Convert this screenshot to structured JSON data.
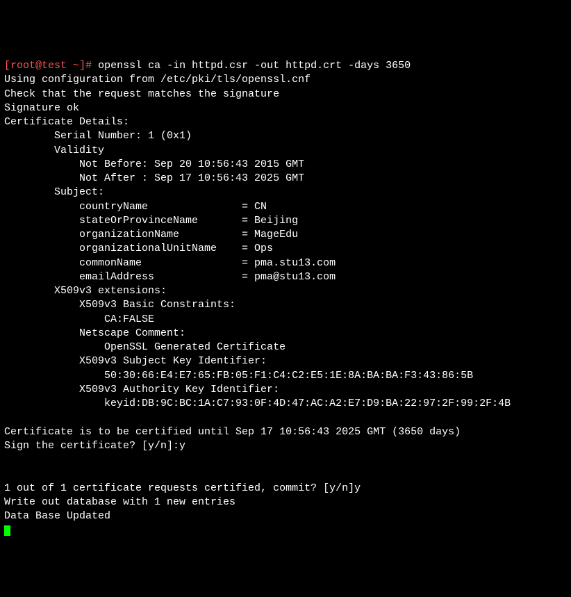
{
  "prompt": {
    "open": "[",
    "userhost": "root@test",
    "space": " ",
    "tilde": "~",
    "close": "]",
    "hash": "# "
  },
  "command": "openssl ca -in httpd.csr -out httpd.crt -days 3650",
  "lines": {
    "l1": "Using configuration from /etc/pki/tls/openssl.cnf",
    "l2": "Check that the request matches the signature",
    "l3": "Signature ok",
    "l4": "Certificate Details:",
    "l5": "        Serial Number: 1 (0x1)",
    "l6": "        Validity",
    "l7": "            Not Before: Sep 20 10:56:43 2015 GMT",
    "l8": "            Not After : Sep 17 10:56:43 2025 GMT",
    "l9": "        Subject:",
    "l10": "            countryName               = CN",
    "l11": "            stateOrProvinceName       = Beijing",
    "l12": "            organizationName          = MageEdu",
    "l13": "            organizationalUnitName    = Ops",
    "l14": "            commonName                = pma.stu13.com",
    "l15": "            emailAddress              = pma@stu13.com",
    "l16": "        X509v3 extensions:",
    "l17": "            X509v3 Basic Constraints: ",
    "l18": "                CA:FALSE",
    "l19": "            Netscape Comment: ",
    "l20": "                OpenSSL Generated Certificate",
    "l21": "            X509v3 Subject Key Identifier: ",
    "l22": "                50:30:66:E4:E7:65:FB:05:F1:C4:C2:E5:1E:8A:BA:BA:F3:43:86:5B",
    "l23": "            X509v3 Authority Key Identifier: ",
    "l24": "                keyid:DB:9C:BC:1A:C7:93:0F:4D:47:AC:A2:E7:D9:BA:22:97:2F:99:2F:4B",
    "l25": "",
    "l26": "Certificate is to be certified until Sep 17 10:56:43 2025 GMT (3650 days)",
    "l27": "Sign the certificate? [y/n]:y",
    "l28": "",
    "l29": "",
    "l30": "1 out of 1 certificate requests certified, commit? [y/n]y",
    "l31": "Write out database with 1 new entries",
    "l32": "Data Base Updated"
  }
}
